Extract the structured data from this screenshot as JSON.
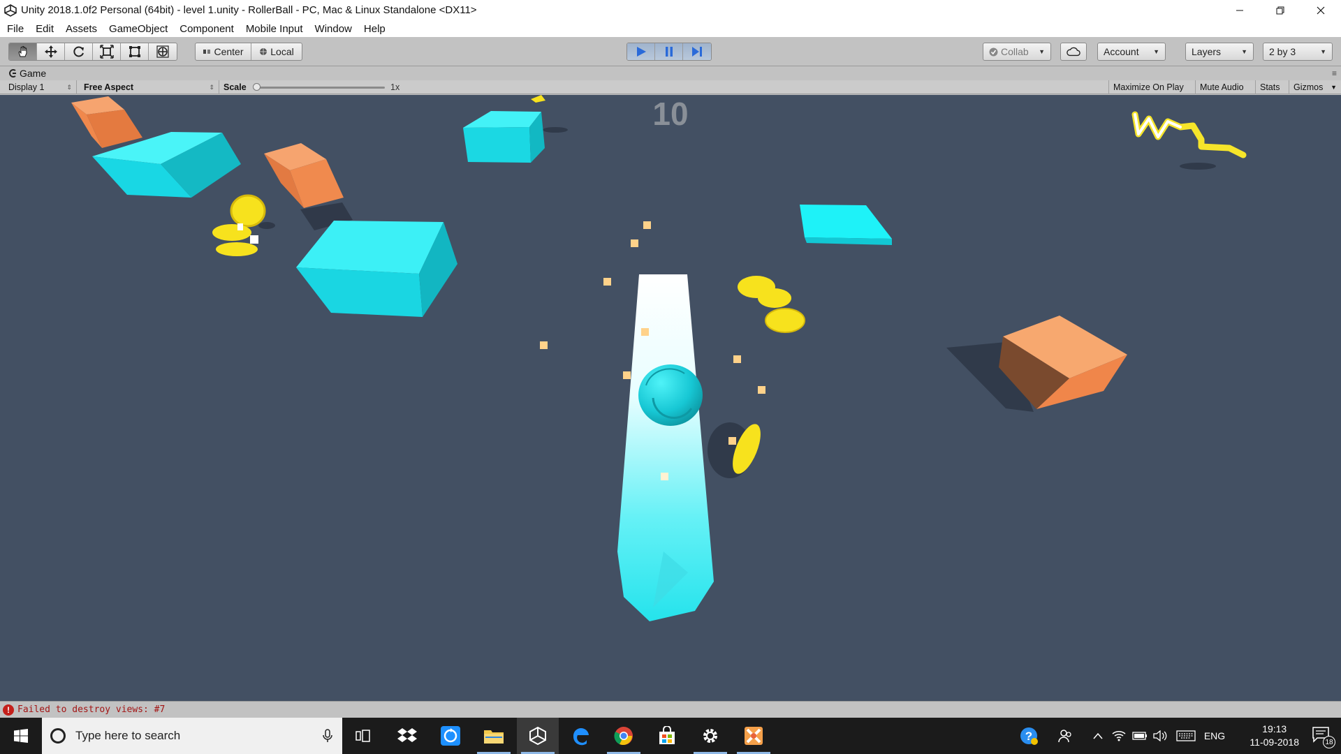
{
  "window": {
    "title": "Unity 2018.1.0f2 Personal (64bit) - level 1.unity - RollerBall - PC, Mac & Linux Standalone <DX11>",
    "controls": [
      "minimize-icon",
      "restore-icon",
      "close-icon"
    ]
  },
  "menu": {
    "items": [
      "File",
      "Edit",
      "Assets",
      "GameObject",
      "Component",
      "Mobile Input",
      "Window",
      "Help"
    ]
  },
  "toolbar": {
    "transform_tools": [
      "hand-icon",
      "move-icon",
      "rotate-icon",
      "scale-icon",
      "rect-tool-icon",
      "transform-tool-icon"
    ],
    "pivot": "Center",
    "space": "Local",
    "play_controls": [
      "play-icon",
      "pause-icon",
      "step-icon"
    ],
    "collab": "Collab",
    "account": "Account",
    "layers": "Layers",
    "layout": "2 by 3"
  },
  "game_tab": {
    "label": "Game"
  },
  "game_bar": {
    "display": "Display 1",
    "aspect": "Free Aspect",
    "scale_label": "Scale",
    "scale_value": "1x",
    "maximize_on_play": "Maximize On Play",
    "mute_audio": "Mute Audio",
    "stats": "Stats",
    "gizmos": "Gizmos"
  },
  "game": {
    "score": "10",
    "colors": {
      "background": "#435063",
      "cyan_block": "#1ee6f0",
      "orange_block": "#f0894f",
      "coin": "#f5e11c",
      "player": "#1ec9d6"
    }
  },
  "status": {
    "message": "Failed to destroy views: #7",
    "level": "error"
  },
  "taskbar": {
    "search_placeholder": "Type here to search",
    "apps": [
      "task-view-icon",
      "dropbox-icon",
      "sync-app-icon",
      "file-explorer-icon",
      "unity-icon",
      "edge-icon",
      "chrome-icon",
      "store-icon",
      "settings-icon",
      "game-app-icon"
    ],
    "tray": [
      "help-icon",
      "people-icon",
      "chevron-up-icon",
      "wifi-icon",
      "battery-icon",
      "volume-icon",
      "keyboard-icon"
    ],
    "language": "ENG",
    "time": "19:13",
    "date": "11-09-2018",
    "notifications": "18"
  }
}
